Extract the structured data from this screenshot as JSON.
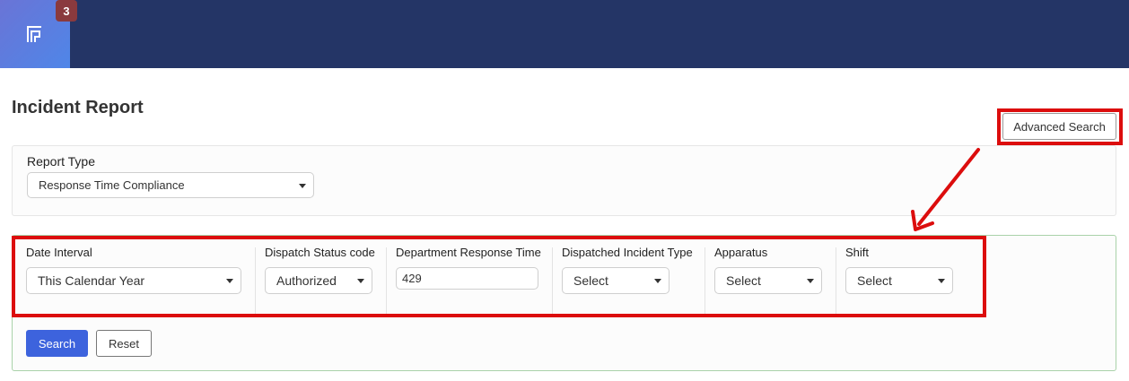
{
  "header": {
    "notification_count": "3",
    "logo_icon": "app-logo-icon"
  },
  "page": {
    "title": "Incident Report"
  },
  "advanced_search": {
    "label": "Advanced Search"
  },
  "report_type": {
    "label": "Report Type",
    "value": "Response Time Compliance"
  },
  "filters": [
    {
      "label": "Date Interval",
      "value": "This Calendar Year",
      "kind": "select"
    },
    {
      "label": "Dispatch Status code",
      "value": "Authorized",
      "kind": "select"
    },
    {
      "label": "Department Response Time",
      "value": "429",
      "kind": "input"
    },
    {
      "label": "Dispatched Incident Type",
      "value": "Select",
      "kind": "select"
    },
    {
      "label": "Apparatus",
      "value": "Select",
      "kind": "select"
    },
    {
      "label": "Shift",
      "value": "Select",
      "kind": "select"
    }
  ],
  "actions": {
    "search_label": "Search",
    "reset_label": "Reset"
  },
  "colors": {
    "header_bg": "#243566",
    "highlight": "#dc0d0d",
    "primary": "#3d63dd"
  }
}
